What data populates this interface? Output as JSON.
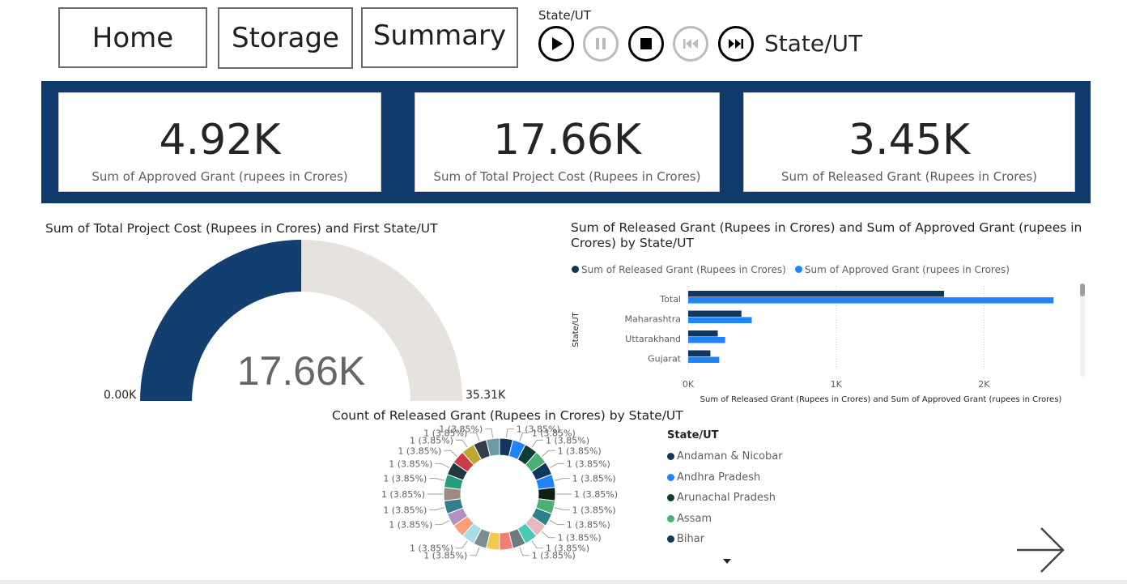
{
  "nav": {
    "home_label": "Home",
    "storage_label": "Storage",
    "summary_label": "Summary"
  },
  "play_axis": {
    "title": "State/UT",
    "current_value": "State/UT",
    "play_icon": "play-icon",
    "pause_icon": "pause-icon",
    "stop_icon": "stop-icon",
    "previous_icon": "skip-previous-icon",
    "next_icon": "skip-next-icon"
  },
  "kpis": [
    {
      "value": "4.92K",
      "label": "Sum of Approved Grant (rupees in Crores)"
    },
    {
      "value": "17.66K",
      "label": "Sum of Total Project Cost (Rupees in Crores)"
    },
    {
      "value": "3.45K",
      "label": "Sum of Released Grant (Rupees in Crores)"
    }
  ],
  "colors": {
    "navy": "#0f3a6b",
    "gauge_fill": "#123e70",
    "gauge_track": "#e6e2dd",
    "released": "#12375f",
    "approved": "#1f85f6"
  },
  "gauge": {
    "title": "Sum of Total Project Cost (Rupees in Crores) and First State/UT",
    "value_label": "17.66K",
    "min_label": "0.00K",
    "max_label": "35.31K"
  },
  "bar_chart": {
    "title_line1": "Sum of Released Grant (Rupees in Crores) and Sum of Approved Grant (rupees in",
    "title_line2": "Crores) by State/UT",
    "y_axis_label": "State/UT",
    "x_axis_label": "Sum of Released Grant (Rupees in Crores) and Sum of Approved Grant (rupees in Crores)",
    "tick_labels": [
      "0K",
      "1K",
      "2K"
    ]
  },
  "donut": {
    "title": "Count of Released Grant (Rupees in Crores) by State/UT",
    "slice_label": "1 (3.85%)",
    "legend_title": "State/UT",
    "legend_items": [
      {
        "name": "Andaman & Nicobar",
        "color": "#12375f"
      },
      {
        "name": "Andhra Pradesh",
        "color": "#1f85f6"
      },
      {
        "name": "Arunachal Pradesh",
        "color": "#0f3d35"
      },
      {
        "name": "Assam",
        "color": "#4caf75"
      },
      {
        "name": "Bihar",
        "color": "#12375f"
      }
    ]
  },
  "chart_data": [
    {
      "type": "gauge",
      "title": "Sum of Total Project Cost (Rupees in Crores) and First State/UT",
      "value": 17660,
      "min": 0,
      "max": 35310
    },
    {
      "type": "bar",
      "orientation": "horizontal",
      "title": "Sum of Released Grant (Rupees in Crores) and Sum of Approved Grant (rupees in Crores) by State/UT",
      "categories": [
        "Total",
        "Maharashtra",
        "Uttarakhand",
        "Gujarat"
      ],
      "series": [
        {
          "name": "Sum of Released Grant (Rupees in Crores)",
          "values": [
            1730,
            360,
            200,
            150
          ]
        },
        {
          "name": "Sum of Approved Grant (rupees in Crores)",
          "values": [
            2470,
            430,
            250,
            210
          ]
        }
      ],
      "xlim": [
        0,
        2600
      ],
      "xticks": [
        0,
        1000,
        2000
      ],
      "ylabel": "State/UT",
      "xlabel": "Sum of Released Grant (Rupees in Crores) and Sum of Approved Grant (rupees in Crores)",
      "legend": "top"
    },
    {
      "type": "pie",
      "donut": true,
      "title": "Count of Released Grant (Rupees in Crores) by State/UT",
      "slice_count": 26,
      "slice_value": 1,
      "slice_percent": 3.85,
      "slice_colors": [
        "#12375f",
        "#1f85f6",
        "#0f3d35",
        "#4caf75",
        "#12375f",
        "#1f85f6",
        "#0d1f16",
        "#4caf75",
        "#2f7f8f",
        "#e8b8c0",
        "#47c9b5",
        "#6b7d82",
        "#f47c72",
        "#f2c94c",
        "#7d8c93",
        "#a7dde8",
        "#fb9e79",
        "#b58fc2",
        "#347e8f",
        "#9d8c84",
        "#2a9a7e",
        "#1f3a3f",
        "#cc3b48",
        "#bfa82e",
        "#323f4b",
        "#6a9aa3"
      ],
      "legend_title": "State/UT",
      "legend_placement": "right"
    }
  ]
}
